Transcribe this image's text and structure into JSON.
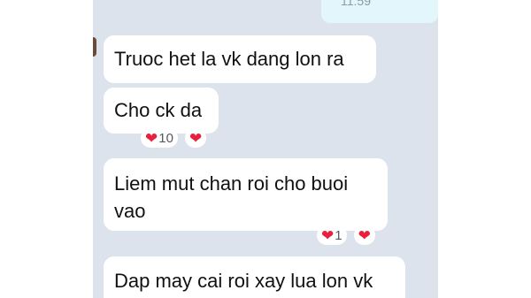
{
  "sent": {
    "time": "11:59"
  },
  "messages": [
    {
      "text": "Truoc het la vk dang lon ra"
    },
    {
      "text": "Cho ck da",
      "reaction_count": "10"
    },
    {
      "text": "Liem mut chan roi cho buoi vao",
      "reaction_count": "1"
    },
    {
      "text": "Dap may cai roi xay lua lon vk"
    }
  ],
  "icons": {
    "reaction": "heart-icon"
  },
  "colors": {
    "chat_bg": "#dde3ec",
    "heart": "#e8203d",
    "sent_bubble": "#e3f6fb"
  }
}
